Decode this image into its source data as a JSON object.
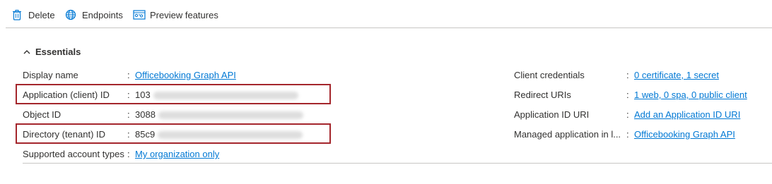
{
  "toolbar": {
    "delete_label": "Delete",
    "endpoints_label": "Endpoints",
    "preview_label": "Preview features"
  },
  "essentials": {
    "header": "Essentials"
  },
  "left": {
    "display_name": {
      "label": "Display name",
      "value": "Officebooking Graph API"
    },
    "app_id": {
      "label": "Application (client) ID",
      "value": "103"
    },
    "object_id": {
      "label": "Object ID",
      "value": "3088"
    },
    "tenant_id": {
      "label": "Directory (tenant) ID",
      "value": "85c9"
    },
    "account_types": {
      "label": "Supported account types",
      "value": "My organization only"
    }
  },
  "right": {
    "client_credentials": {
      "label": "Client credentials",
      "value": "0 certificate, 1 secret"
    },
    "redirect_uris": {
      "label": "Redirect URIs",
      "value": "1 web, 0 spa, 0 public client"
    },
    "app_id_uri": {
      "label": "Application ID URI",
      "value": "Add an Application ID URI"
    },
    "managed_app": {
      "label": "Managed application in l...",
      "value": "Officebooking Graph API"
    }
  },
  "colon": ":",
  "colors": {
    "link": "#0078d4",
    "highlight": "#a4262c",
    "icon": "#0078d4"
  }
}
